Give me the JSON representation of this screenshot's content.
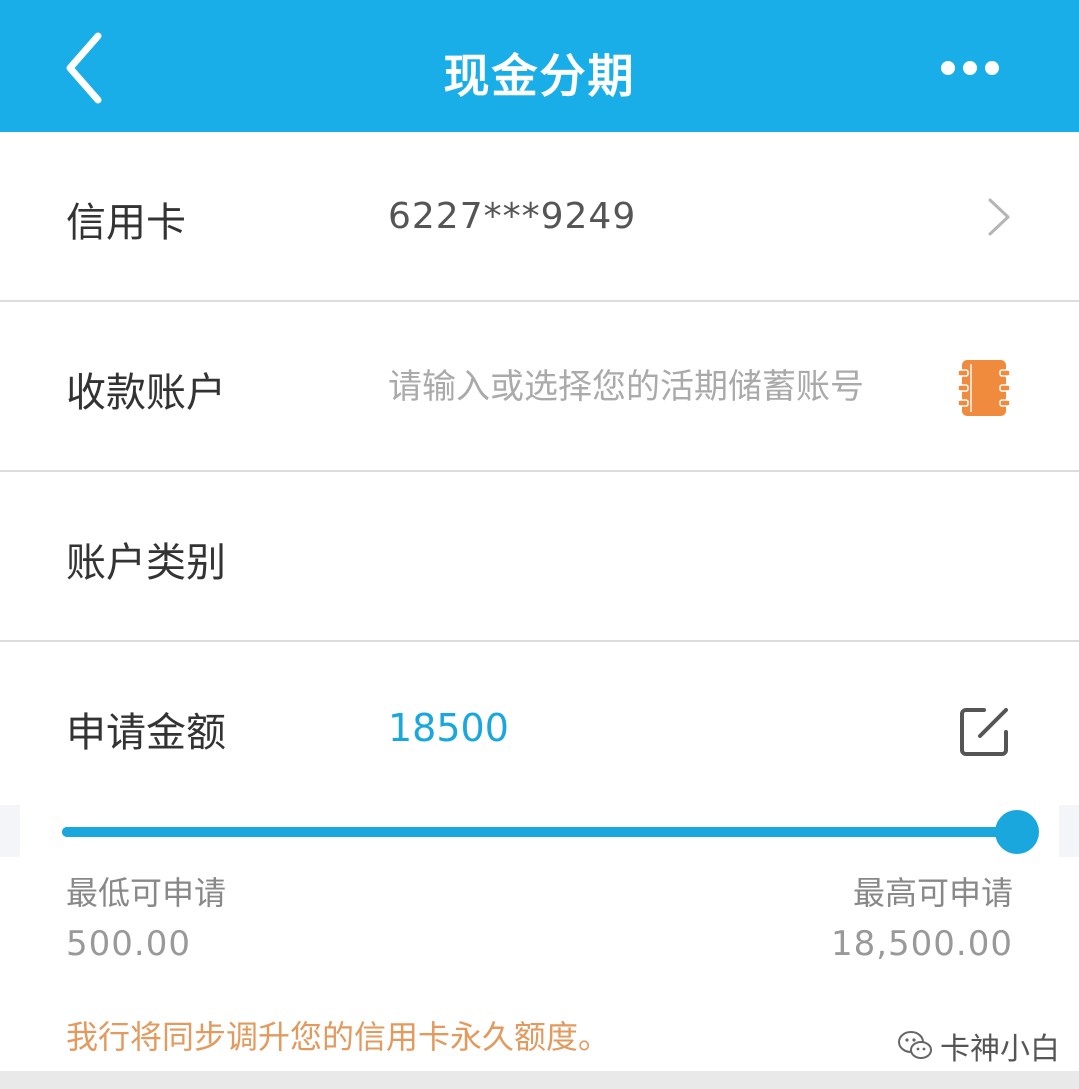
{
  "header": {
    "title": "现金分期",
    "background_color": "#1aaee8",
    "back_icon": "chevron-left-icon",
    "more_icon": "more-horizontal-icon"
  },
  "form": {
    "credit_card": {
      "label": "信用卡",
      "value": "6227***9249",
      "icon": "chevron-right-icon"
    },
    "receiving_account": {
      "label": "收款账户",
      "placeholder": "请输入或选择您的活期储蓄账号",
      "value": "",
      "icon": "address-book-icon",
      "icon_color": "#f08a3c"
    },
    "account_type": {
      "label": "账户类别",
      "value": ""
    },
    "amount": {
      "label": "申请金额",
      "value": "18500",
      "value_color": "#1aa7dd",
      "icon": "edit-icon"
    }
  },
  "slider": {
    "fill_fraction": 1.0,
    "min_label": "最低可申请",
    "min_value": "500.00",
    "max_label": "最高可申请",
    "max_value": "18,500.00",
    "color": "#1aa7dd"
  },
  "notice": {
    "text": "我行将同步调升您的信用卡永久额度。",
    "color": "#e29a5e"
  },
  "watermark": {
    "icon": "wechat-icon",
    "text": "卡神小白"
  }
}
